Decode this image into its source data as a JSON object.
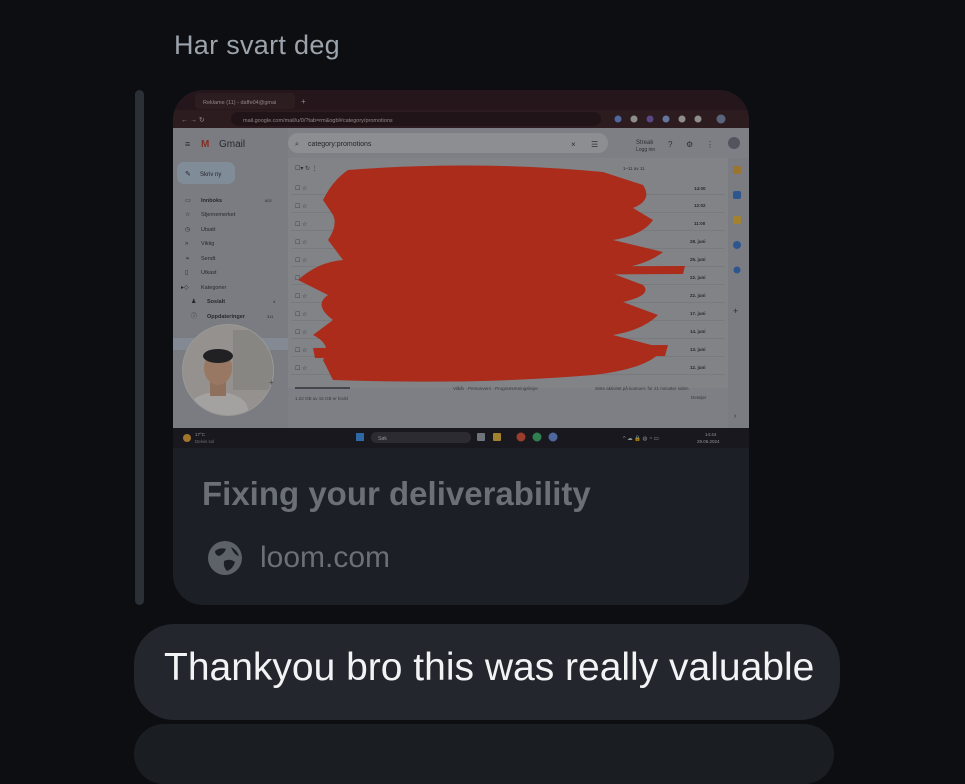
{
  "reply": {
    "label": "Har svart deg"
  },
  "link_preview": {
    "title": "Fixing your deliverability",
    "domain": "loom.com",
    "icon": "globe-icon",
    "screenshot": {
      "browser": {
        "tab_title": "Reklame (11) - daffe04@gmai",
        "url": "mail.google.com/mail/u/0/?tab=rm&ogbl#category/promotions"
      },
      "gmail": {
        "logo_text": "Gmail",
        "search_value": "category:promotions",
        "streak_label": "Streak",
        "streak_sub": "Logg inn",
        "compose_label": "Skriv ny",
        "nav": [
          {
            "label": "Innboks",
            "count": "602"
          },
          {
            "label": "Stjernemerket",
            "count": ""
          },
          {
            "label": "Utsatt",
            "count": ""
          },
          {
            "label": "Viktig",
            "count": ""
          },
          {
            "label": "Sendt",
            "count": ""
          },
          {
            "label": "Utkast",
            "count": ""
          },
          {
            "label": "Kategorier",
            "count": ""
          },
          {
            "label": "Sosialt",
            "count": "4"
          },
          {
            "label": "Oppdateringer",
            "count": "311"
          }
        ],
        "promo_count": "11",
        "pagination": "1–11 av 11",
        "times": [
          "14:00",
          "12:02",
          "11:00",
          "28. juni",
          "25. juni",
          "22. juni",
          "22. juni",
          "17. juni",
          "14. juni",
          "13. juni",
          "12. juni"
        ],
        "storage": "1,22 GB av 15 GB er brukt",
        "footer_links": "Vilkår · Personvern · Programretningslinjer",
        "activity": "Siste aktivitet på kontoen: for 21 minutter siden",
        "activity_detail": "Detaljer"
      },
      "taskbar": {
        "weather_temp": "17°C",
        "weather_desc": "Delvis sol",
        "search": "Søk",
        "time": "14:44",
        "date": "29.06.2024"
      }
    }
  },
  "message": {
    "text": "Thankyou bro this was really valuable"
  }
}
